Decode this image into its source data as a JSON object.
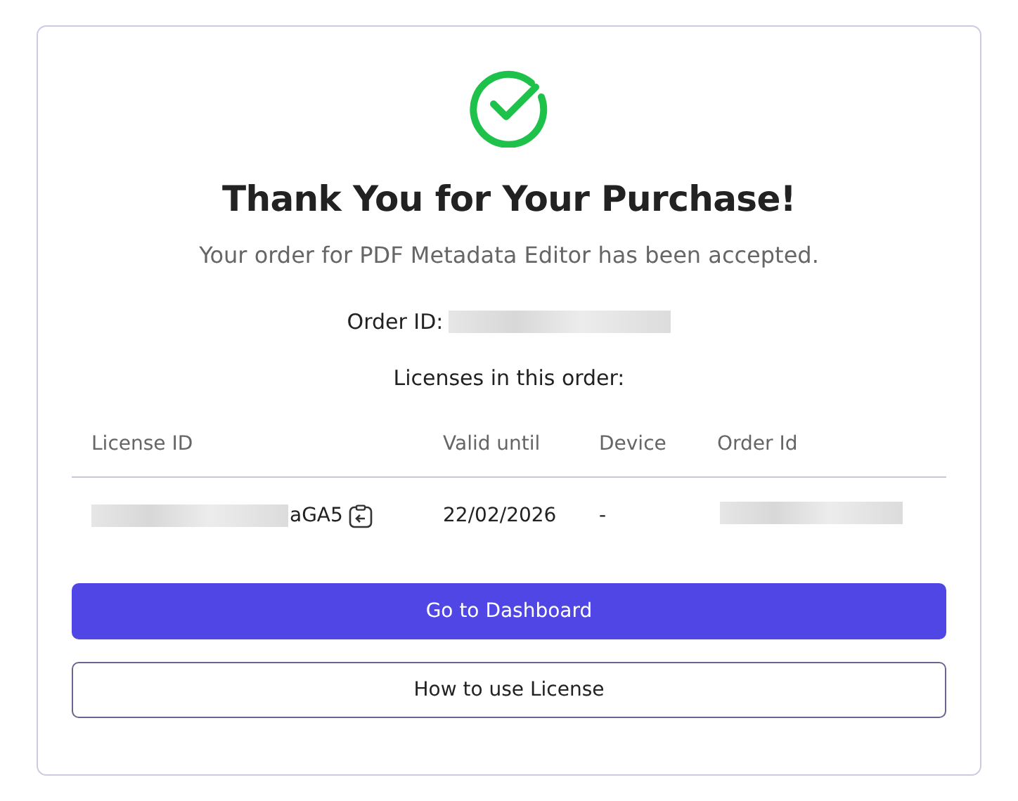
{
  "title": "Thank You for Your Purchase!",
  "subtitle": "Your order for PDF Metadata Editor has been accepted.",
  "order_id": {
    "label": "Order ID:"
  },
  "licenses_heading": "Licenses in this order:",
  "table": {
    "columns": [
      "License ID",
      "Valid until",
      "Device",
      "Order Id"
    ],
    "rows": [
      {
        "license_id": "aGA5",
        "valid_until": "22/02/2026",
        "device": "-"
      }
    ]
  },
  "buttons": [
    {
      "label": "Go to Dashboard",
      "kind": "primary"
    },
    {
      "label": "How to use License",
      "kind": "outline"
    }
  ]
}
